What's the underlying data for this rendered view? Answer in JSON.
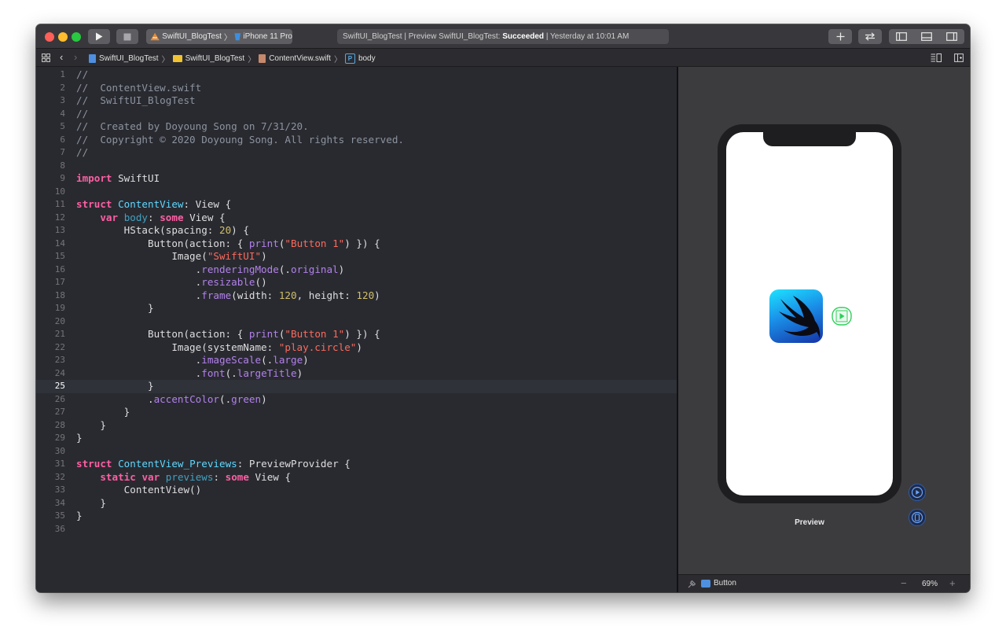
{
  "toolbar": {
    "scheme_name": "SwiftUI_BlogTest",
    "device": "iPhone 11 Pro",
    "activity_prefix": "SwiftUI_BlogTest | Preview SwiftUI_BlogTest:",
    "activity_status": "Succeeded",
    "activity_suffix": "| Yesterday at 10:01 AM"
  },
  "jumpbar": {
    "project": "SwiftUI_BlogTest",
    "folder": "SwiftUI_BlogTest",
    "file": "ContentView.swift",
    "symbol_badge": "P",
    "symbol": "body"
  },
  "editor": {
    "current_line": 25,
    "lines": [
      [
        [
          "c",
          "//"
        ]
      ],
      [
        [
          "c",
          "//  ContentView.swift"
        ]
      ],
      [
        [
          "c",
          "//  SwiftUI_BlogTest"
        ]
      ],
      [
        [
          "c",
          "//"
        ]
      ],
      [
        [
          "c",
          "//  Created by Doyoung Song on 7/31/20."
        ]
      ],
      [
        [
          "c",
          "//  Copyright © 2020 Doyoung Song. All rights reserved."
        ]
      ],
      [
        [
          "c",
          "//"
        ]
      ],
      [],
      [
        [
          "k",
          "import"
        ],
        [
          "p",
          " SwiftUI"
        ]
      ],
      [],
      [
        [
          "k",
          "struct"
        ],
        [
          "p",
          " "
        ],
        [
          "t",
          "ContentView"
        ],
        [
          "p",
          ": View {"
        ]
      ],
      [
        [
          "p",
          "    "
        ],
        [
          "k",
          "var"
        ],
        [
          "p",
          " "
        ],
        [
          "b",
          "body"
        ],
        [
          "p",
          ": "
        ],
        [
          "k",
          "some"
        ],
        [
          "p",
          " View {"
        ]
      ],
      [
        [
          "p",
          "        HStack(spacing: "
        ],
        [
          "n",
          "20"
        ],
        [
          "p",
          ") {"
        ]
      ],
      [
        [
          "p",
          "            Button(action: { "
        ],
        [
          "m",
          "print"
        ],
        [
          "p",
          "("
        ],
        [
          "s",
          "\"Button 1\""
        ],
        [
          "p",
          ") }) {"
        ]
      ],
      [
        [
          "p",
          "                Image("
        ],
        [
          "s",
          "\"SwiftUI\""
        ],
        [
          "p",
          ")"
        ]
      ],
      [
        [
          "p",
          "                    ."
        ],
        [
          "m",
          "renderingMode"
        ],
        [
          "p",
          "(."
        ],
        [
          "m",
          "original"
        ],
        [
          "p",
          ")"
        ]
      ],
      [
        [
          "p",
          "                    ."
        ],
        [
          "m",
          "resizable"
        ],
        [
          "p",
          "()"
        ]
      ],
      [
        [
          "p",
          "                    ."
        ],
        [
          "m",
          "frame"
        ],
        [
          "p",
          "(width: "
        ],
        [
          "n",
          "120"
        ],
        [
          "p",
          ", height: "
        ],
        [
          "n",
          "120"
        ],
        [
          "p",
          ")"
        ]
      ],
      [
        [
          "p",
          "            }"
        ]
      ],
      [],
      [
        [
          "p",
          "            Button(action: { "
        ],
        [
          "m",
          "print"
        ],
        [
          "p",
          "("
        ],
        [
          "s",
          "\"Button 1\""
        ],
        [
          "p",
          ") }) {"
        ]
      ],
      [
        [
          "p",
          "                Image(systemName: "
        ],
        [
          "s",
          "\"play.circle\""
        ],
        [
          "p",
          ")"
        ]
      ],
      [
        [
          "p",
          "                    ."
        ],
        [
          "m",
          "imageScale"
        ],
        [
          "p",
          "(."
        ],
        [
          "m",
          "large"
        ],
        [
          "p",
          ")"
        ]
      ],
      [
        [
          "p",
          "                    ."
        ],
        [
          "m",
          "font"
        ],
        [
          "p",
          "(."
        ],
        [
          "m",
          "largeTitle"
        ],
        [
          "p",
          ")"
        ]
      ],
      [
        [
          "p",
          "            }"
        ]
      ],
      [
        [
          "p",
          "            ."
        ],
        [
          "m",
          "accentColor"
        ],
        [
          "p",
          "(."
        ],
        [
          "m",
          "green"
        ],
        [
          "p",
          ")"
        ]
      ],
      [
        [
          "p",
          "        }"
        ]
      ],
      [
        [
          "p",
          "    }"
        ]
      ],
      [
        [
          "p",
          "}"
        ]
      ],
      [],
      [
        [
          "k",
          "struct"
        ],
        [
          "p",
          " "
        ],
        [
          "t",
          "ContentView_Previews"
        ],
        [
          "p",
          ": PreviewProvider {"
        ]
      ],
      [
        [
          "p",
          "    "
        ],
        [
          "k",
          "static"
        ],
        [
          "p",
          " "
        ],
        [
          "k",
          "var"
        ],
        [
          "p",
          " "
        ],
        [
          "b",
          "previews"
        ],
        [
          "p",
          ": "
        ],
        [
          "k",
          "some"
        ],
        [
          "p",
          " View {"
        ]
      ],
      [
        [
          "p",
          "        ContentView()"
        ]
      ],
      [
        [
          "p",
          "    }"
        ]
      ],
      [
        [
          "p",
          "}"
        ]
      ],
      []
    ]
  },
  "syntax_colors": {
    "c": "#8c939e",
    "k": "#fc5fa3",
    "t": "#5dd8ff",
    "b": "#41a1c0",
    "m": "#b281eb",
    "s": "#fc6a5d",
    "n": "#d0bf69",
    "p": "#dfdfe0"
  },
  "preview": {
    "label": "Preview",
    "accent_color": "#2fcf5a"
  },
  "statusbar": {
    "selection": "Button",
    "zoom": "69%"
  }
}
